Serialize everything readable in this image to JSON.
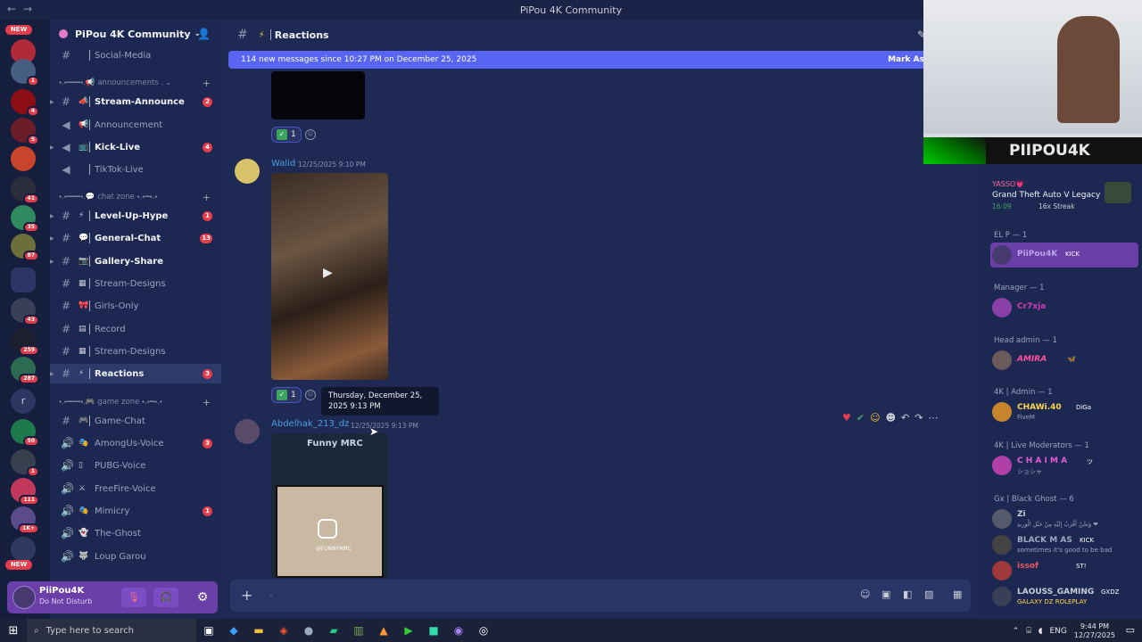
{
  "window": {
    "title": "PiPou 4K Community"
  },
  "server_rail": {
    "new_top": "NEW",
    "new_bottom": "NEW",
    "letter_server": "r",
    "badges": [
      "1",
      "4",
      "5",
      "1",
      "41",
      "35",
      "87",
      "43",
      "259",
      "287",
      "50",
      "1",
      "111",
      "1K+"
    ]
  },
  "guild": {
    "name": "PiPou 4K Community"
  },
  "channels": [
    {
      "name": "Social-Media",
      "type": "#",
      "emoji": "",
      "bold": false,
      "count": ""
    },
    {
      "name": "Stream-Announce",
      "type": "#",
      "emoji": "📣",
      "bold": true,
      "count": "2"
    },
    {
      "name": "Announcement",
      "type": "◀",
      "emoji": "📢",
      "bold": false,
      "count": ""
    },
    {
      "name": "Kick-Live",
      "type": "◀",
      "emoji": "📺",
      "bold": true,
      "count": "4"
    },
    {
      "name": "TikTok-Live",
      "type": "◀",
      "emoji": "",
      "bold": false,
      "count": ""
    },
    {
      "name": "Level-Up-Hype",
      "type": "#",
      "emoji": "⚡",
      "bold": true,
      "count": "1"
    },
    {
      "name": "General-Chat",
      "type": "#",
      "emoji": "💬",
      "bold": true,
      "count": "13"
    },
    {
      "name": "Gallery-Share",
      "type": "#",
      "emoji": "📷",
      "bold": true,
      "count": ""
    },
    {
      "name": "Stream-Designs",
      "type": "#",
      "emoji": "▦",
      "bold": false,
      "count": ""
    },
    {
      "name": "Girls-Only",
      "type": "#",
      "emoji": "🎀",
      "bold": false,
      "count": ""
    },
    {
      "name": "Record",
      "type": "#",
      "emoji": "▤",
      "bold": false,
      "count": ""
    },
    {
      "name": "Stream-Designs",
      "type": "#",
      "emoji": "▦",
      "bold": false,
      "count": ""
    },
    {
      "name": "Reactions",
      "type": "#",
      "emoji": "⚡",
      "bold": true,
      "count": "3"
    },
    {
      "name": "Game-Chat",
      "type": "#",
      "emoji": "🎮",
      "bold": false,
      "count": ""
    },
    {
      "name": "AmongUs-Voice",
      "type": "🔊",
      "emoji": "🎭",
      "bold": false,
      "count": "3"
    },
    {
      "name": "PUBG-Voice",
      "type": "🔊",
      "emoji": "▯",
      "bold": false,
      "count": ""
    },
    {
      "name": "FreeFire-Voice",
      "type": "🔊",
      "emoji": "⚔",
      "bold": false,
      "count": ""
    },
    {
      "name": "Mimicry",
      "type": "🔊",
      "emoji": "🎭",
      "bold": false,
      "count": "1"
    },
    {
      "name": "The-Ghost",
      "type": "🔊",
      "emoji": "👻",
      "bold": false,
      "count": ""
    },
    {
      "name": "Loup Garou",
      "type": "🔊",
      "emoji": "🐺",
      "bold": false,
      "count": ""
    }
  ],
  "categories": {
    "announcements": "⬩.⬩━━━⬩.📢 announcements .",
    "chat_zone": "⬩.⬩━━━⬩.💬 chat zone ⬩.⬩━⬩.⬩",
    "game_zone": "⬩.⬩━━━⬩.🎮 game zone ⬩.⬩━⬩.⬩"
  },
  "user": {
    "name": "PiiPou4K",
    "status": "Do Not Disturb"
  },
  "header": {
    "channel": "Reactions"
  },
  "banner": {
    "text": "114 new messages since 10:27 PM on December 25, 2025",
    "action": "Mark As"
  },
  "messages": {
    "first_react_count": "1",
    "walid": {
      "author": "Walid",
      "time": "12/25/2025 9:10 PM",
      "react_count": "1"
    },
    "abdelhak": {
      "author": "Abdelhak_213_dz",
      "time": "12/25/2025 9:13 PM",
      "media_title": "Funny MRC",
      "media_handle": "@FUNNYMRC"
    }
  },
  "tooltip": {
    "text": "Thursday, December 25, 2025 9:13 PM"
  },
  "composer": {
    "placeholder": "-"
  },
  "webcam": {
    "brand": "PIIPOU4K"
  },
  "activity": {
    "user": "YASSO💗",
    "game": "Grand Theft Auto V Legacy",
    "time": "16:09",
    "streak": "16x Streak"
  },
  "member_groups": [
    {
      "label": "EL P — 1",
      "members": [
        {
          "name": "PiiPou4K",
          "tag": "KICK",
          "sub": "",
          "color": "#b9a6e8"
        }
      ]
    },
    {
      "label": "Manager — 1",
      "members": [
        {
          "name": "Cr7xja",
          "tag": "",
          "sub": "",
          "color": "#d63bb4"
        }
      ]
    },
    {
      "label": "Head admin — 1",
      "members": [
        {
          "name": "AMIRA",
          "tag": "🦋",
          "sub": "",
          "color": "#ff4fa0"
        }
      ]
    },
    {
      "label": "4K | Admin — 1",
      "members": [
        {
          "name": "CHAWi.40",
          "tag": "DiGa",
          "sub": "FiveM",
          "color": "#ffd84a"
        }
      ]
    },
    {
      "label": "4K | Live Moderators — 1",
      "members": [
        {
          "name": "C H A I M A",
          "tag": "ツ",
          "sub": "ショシャ",
          "color": "#e85bd8"
        }
      ]
    },
    {
      "label": "Gx | Black Ghost — 6",
      "members": [
        {
          "name": "Zi",
          "tag": "",
          "sub": "وَنَحْنُ أَقْرَبُ إِلَيْهِ مِنْ حَبْلِ الْوَرِيدِ ❤",
          "color": "#c9cdd6"
        },
        {
          "name": "BLACK M AS",
          "tag": "KICK",
          "sub": "sometimes it's good to be bad",
          "color": "#a0a6c0"
        },
        {
          "name": "issof",
          "tag": "ST!",
          "sub": "",
          "color": "#e85b5b"
        },
        {
          "name": "LAOUSS_GAMING",
          "tag": "GXDZ",
          "sub": "GALAXY DZ ROLEPLAY",
          "color": "#c9cdd6"
        }
      ]
    }
  ],
  "taskbar": {
    "search_placeholder": "Type here to search",
    "lang": "ENG",
    "time": "9:44 PM",
    "date": "12/27/2025"
  }
}
